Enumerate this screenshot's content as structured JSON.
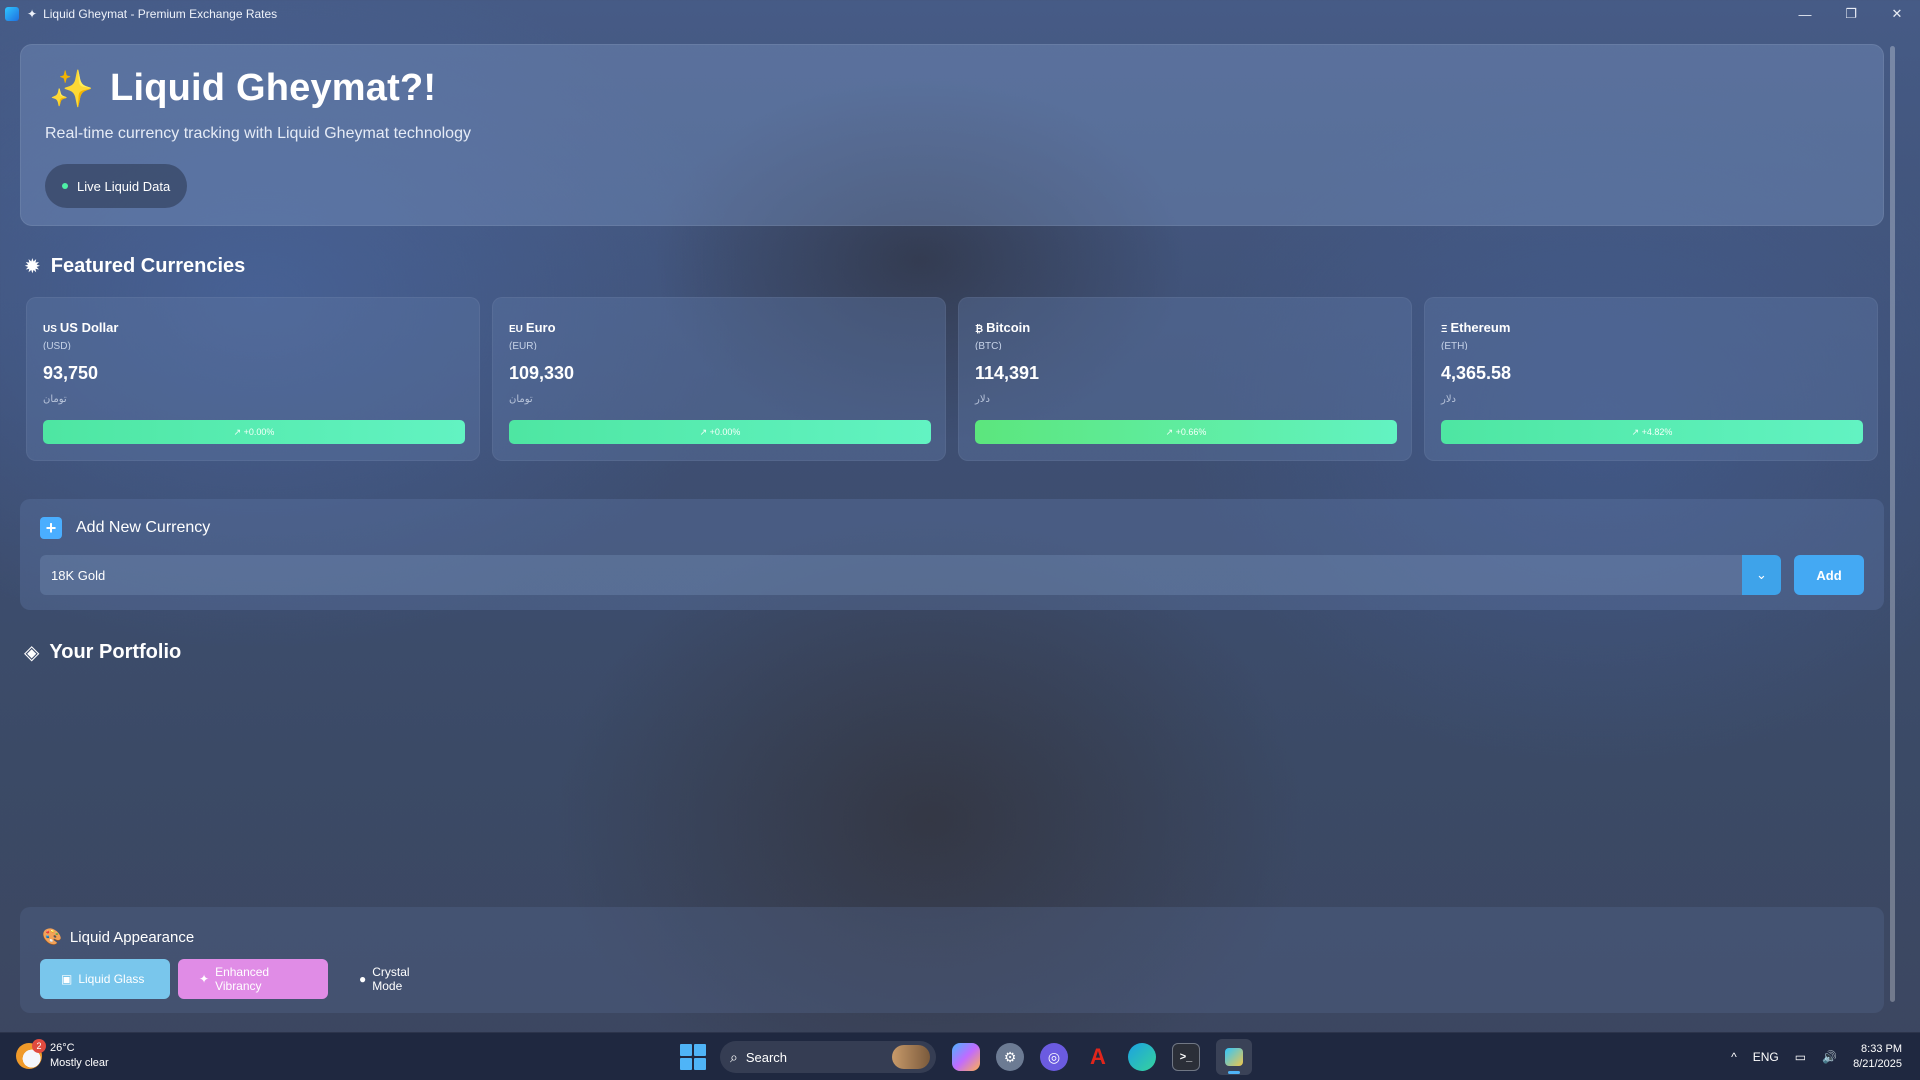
{
  "window": {
    "title": "Liquid Gheymat - Premium Exchange Rates",
    "controls": {
      "minimize": "—",
      "restore": "❐",
      "close": "✕"
    }
  },
  "header": {
    "icon": "sparkle-icon",
    "icon_glyph": "✨",
    "title": "Liquid Gheymat?!",
    "subtitle": "Real-time currency tracking with Liquid Gheymat technology",
    "live_badge": "Live Liquid Data"
  },
  "featured": {
    "icon_glyph": "✹",
    "title": "Featured Currencies",
    "cards": [
      {
        "flag": "US",
        "name": "US Dollar",
        "code": "(USD)",
        "value": "93,750",
        "unit": "تومان",
        "change": "↗ +0.00%"
      },
      {
        "flag": "EU",
        "name": "Euro",
        "code": "(EUR)",
        "value": "109,330",
        "unit": "تومان",
        "change": "↗ +0.00%"
      },
      {
        "flag": "₿",
        "name": "Bitcoin",
        "code": "(BTC)",
        "value": "114,391",
        "unit": "دلار",
        "change": "↗ +0.66%"
      },
      {
        "flag": "Ξ",
        "name": "Ethereum",
        "code": "(ETH)",
        "value": "4,365.58",
        "unit": "دلار",
        "change": "↗ +4.82%"
      }
    ]
  },
  "add_currency": {
    "title": "Add New Currency",
    "selected": "18K Gold",
    "add_label": "Add"
  },
  "portfolio": {
    "icon_glyph": "◈",
    "title": "Your Portfolio"
  },
  "appearance": {
    "icon_glyph": "🎨",
    "title": "Liquid Appearance",
    "modes": [
      {
        "label": "Liquid Glass",
        "icon_glyph": "▣"
      },
      {
        "label": "Enhanced Vibrancy",
        "icon_glyph": "✦"
      },
      {
        "label": "Crystal Mode",
        "icon_glyph": "●"
      }
    ]
  },
  "taskbar": {
    "weather": {
      "badge": "2",
      "temp": "26°C",
      "condition": "Mostly clear"
    },
    "search_placeholder": "Search",
    "tray": {
      "chevron": "^",
      "language": "ENG",
      "network": "▭",
      "volume": "🔊"
    },
    "clock": {
      "time": "8:33 PM",
      "date": "8/21/2025"
    }
  },
  "colors": {
    "accent_blue": "#44a9f3",
    "change_green": "#4ee6a2",
    "glass_button": "#79c6ec",
    "vibrancy_button": "#e08ce6",
    "live_dot": "#4ef0a6"
  }
}
